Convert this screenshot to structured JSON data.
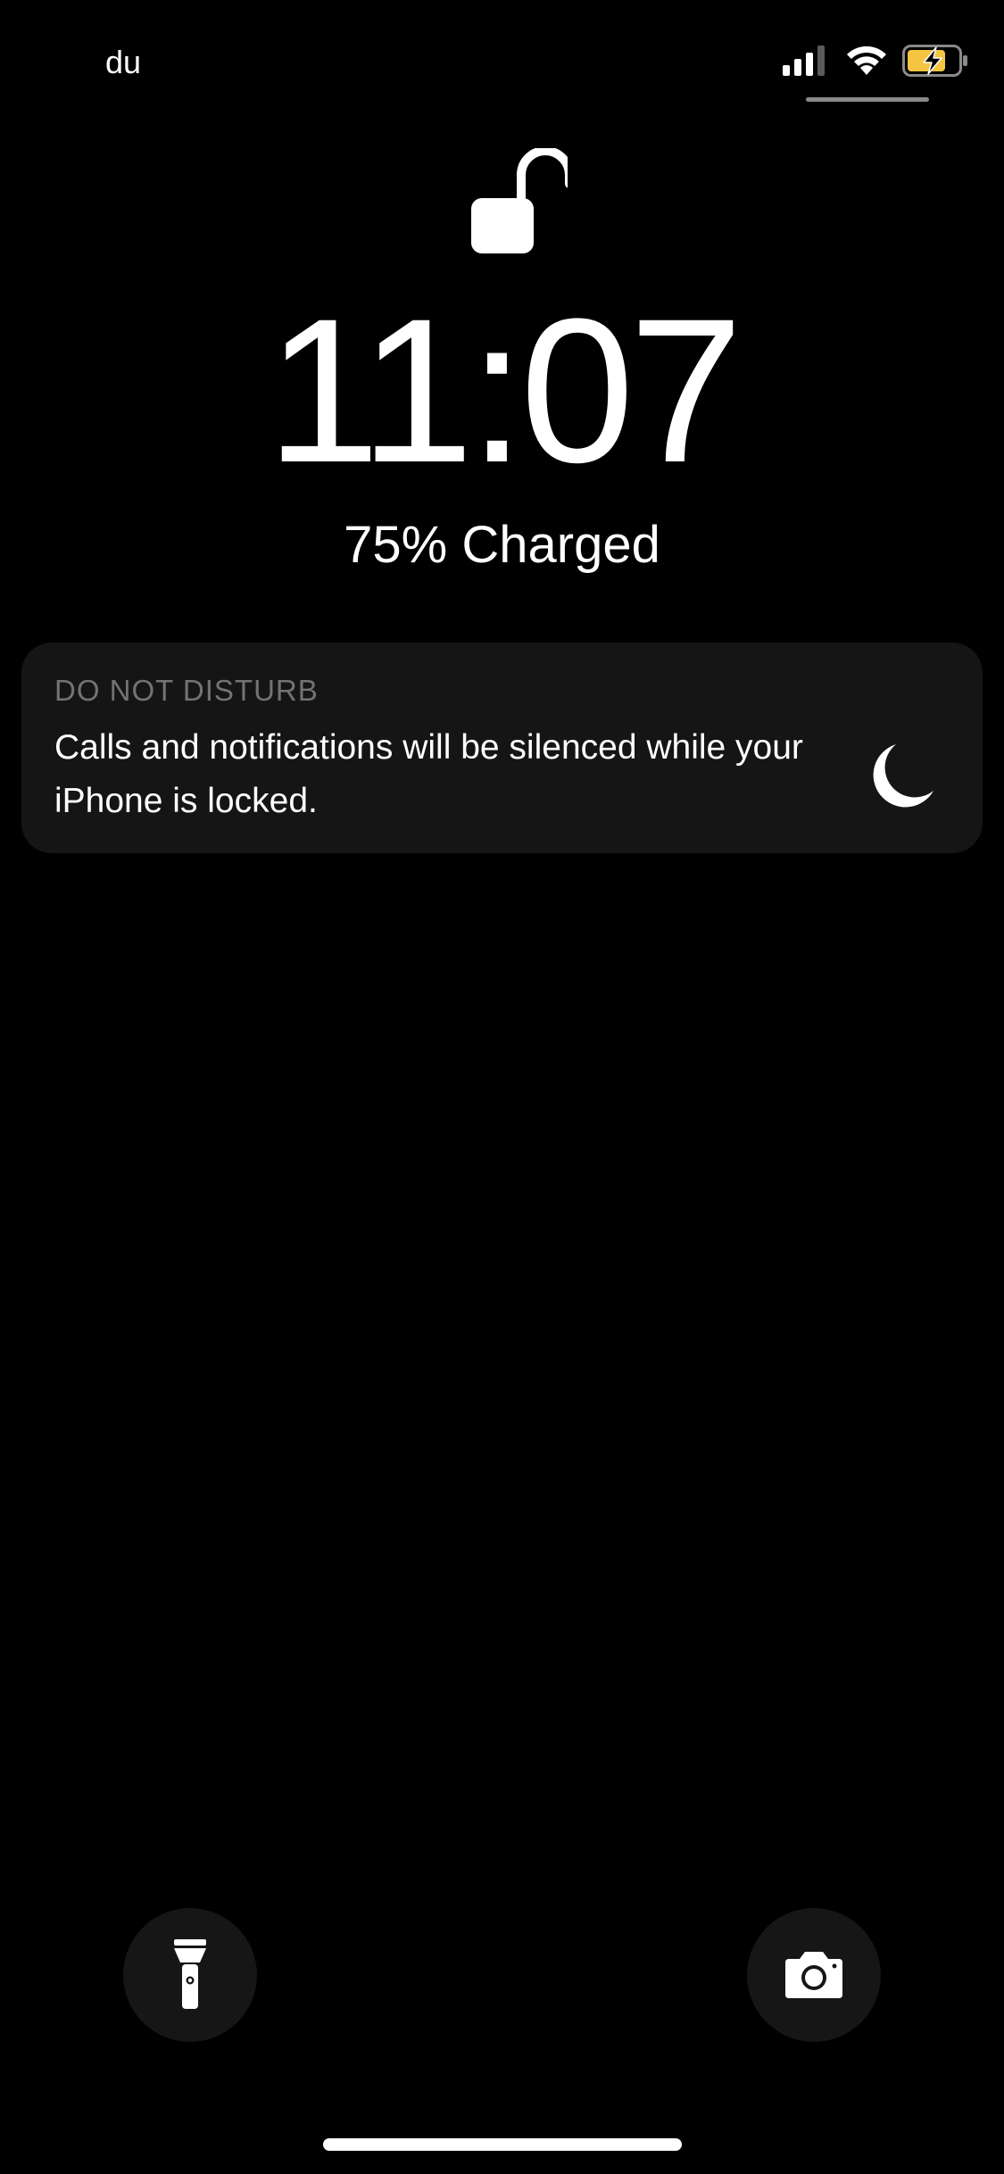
{
  "status_bar": {
    "carrier": "du",
    "icons": [
      "signal-icon",
      "wifi-icon",
      "battery-charging-icon"
    ],
    "battery_color": "#f5c542"
  },
  "lock_screen": {
    "lock_icon": "unlocked-padlock-icon",
    "time": "11:07",
    "charge_status": "75% Charged"
  },
  "notification": {
    "title": "DO NOT DISTURB",
    "body": "Calls and notifications will be silenced while your iPhone is locked.",
    "icon": "moon-icon"
  },
  "quick_actions": {
    "left_icon": "flashlight-icon",
    "right_icon": "camera-icon"
  }
}
